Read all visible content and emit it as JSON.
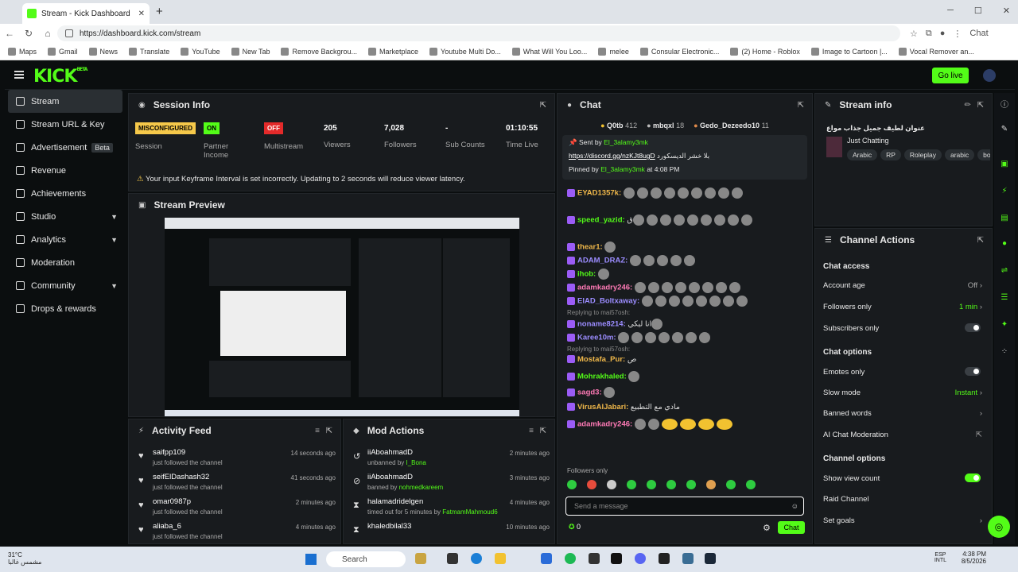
{
  "browser": {
    "tab_title": "Stream - Kick Dashboard",
    "url": "https://dashboard.kick.com/stream",
    "chat_label": "Chat",
    "bookmarks": [
      "Maps",
      "Gmail",
      "News",
      "Translate",
      "YouTube",
      "New Tab",
      "Remove Backgrou...",
      "Marketplace",
      "Youtube Multi Do...",
      "What Will You Loo...",
      "melee",
      "Consular Electronic...",
      "(2) Home - Roblox",
      "Image to Cartoon |...",
      "Vocal Remover an..."
    ]
  },
  "header": {
    "logo": "KICK",
    "logo_beta": "BETA",
    "go_live": "Go live"
  },
  "sidebar": {
    "items": [
      {
        "label": "Stream"
      },
      {
        "label": "Stream URL & Key"
      },
      {
        "label": "Advertisement",
        "badge": "Beta"
      },
      {
        "label": "Revenue"
      },
      {
        "label": "Achievements"
      },
      {
        "label": "Studio"
      },
      {
        "label": "Analytics"
      },
      {
        "label": "Moderation"
      },
      {
        "label": "Community"
      },
      {
        "label": "Drops & rewards"
      }
    ]
  },
  "session": {
    "title": "Session Info",
    "session_badge": "MISCONFIGURED",
    "session_label": "Session",
    "partner_badge": "ON",
    "partner_label": "Partner Income",
    "multistream_badge": "OFF",
    "multistream_label": "Multistream",
    "viewers": "205",
    "viewers_label": "Viewers",
    "followers": "7,028",
    "followers_label": "Followers",
    "subs": "-",
    "subs_label": "Sub Counts",
    "time": "01:10:55",
    "time_label": "Time Live",
    "warning": "Your input Keyframe Interval is set incorrectly. Updating to 2 seconds will reduce viewer latency."
  },
  "preview": {
    "title": "Stream Preview"
  },
  "activity": {
    "title": "Activity Feed",
    "items": [
      {
        "name": "saifpp109",
        "sub": "just followed the channel",
        "time": "14 seconds ago"
      },
      {
        "name": "seifElDashash32",
        "sub": "just followed the channel",
        "time": "41 seconds ago"
      },
      {
        "name": "omar0987p",
        "sub": "just followed the channel",
        "time": "2 minutes ago"
      },
      {
        "name": "aliaba_6",
        "sub": "just followed the channel",
        "time": "4 minutes ago"
      }
    ]
  },
  "mod": {
    "title": "Mod Actions",
    "items": [
      {
        "name": "iiAboahmadD",
        "sub": "unbanned by",
        "by": "I_Bona",
        "time": "2 minutes ago"
      },
      {
        "name": "iiAboahmadD",
        "sub": "banned by",
        "by": "nohmedkareem",
        "time": "3 minutes ago"
      },
      {
        "name": "halamadridelgen",
        "sub": "timed out for 5 minutes by",
        "by": "FatmamMahmoud6",
        "time": "4 minutes ago"
      },
      {
        "name": "khaledbilal33",
        "sub": "",
        "by": "",
        "time": "10 minutes ago"
      }
    ]
  },
  "chat": {
    "title": "Chat",
    "pins": [
      {
        "name": "Q0tb",
        "count": "412"
      },
      {
        "name": "mbqxl",
        "count": "18"
      },
      {
        "name": "Gedo_Dezeedo10",
        "count": "11"
      }
    ],
    "pinned_sent_by": "Sent by",
    "pinned_sender": "El_3alamy3mk",
    "pinned_link": "https://discord.gg/nzKJt8ugD",
    "pinned_text": "بلا خشر الديسكورد",
    "pinned_by": "Pinned by",
    "pinned_at": "at 4:08 PM",
    "messages": [
      {
        "user": "EYAD1357k:",
        "text": ""
      },
      {
        "user": "speed_yazid:",
        "text": "ق"
      },
      {
        "user": "thear1:",
        "text": ""
      },
      {
        "user": "ADAM_DRAZ:",
        "text": ""
      },
      {
        "user": "ihob:",
        "text": ""
      },
      {
        "user": "adamkadry246:",
        "text": ""
      },
      {
        "user": "ElAD_Boltxaway:",
        "text": ""
      },
      {
        "user": "noname8214:",
        "text": "انا ليكي",
        "reply": "Replying to mai57osh:"
      },
      {
        "user": "Karee10m:",
        "text": ""
      },
      {
        "user": "Mostafa_Pur:",
        "text": "ص",
        "reply": "Replying to mai57osh:"
      },
      {
        "user": "Mohrakhaled:",
        "text": ""
      },
      {
        "user": "sagd3:",
        "text": ""
      },
      {
        "user": "VirusAlJabari:",
        "text": "مادي مع التطبيع"
      },
      {
        "user": "adamkadry246:",
        "text": ""
      }
    ],
    "followers_only": "Followers only",
    "placeholder": "Send a message",
    "points": "0",
    "send": "Chat"
  },
  "stream_info": {
    "title": "Stream info",
    "stream_title": "عنوان لطيف جميل جذاب مواع",
    "category": "Just Chatting",
    "tags": [
      "Arabic",
      "RP",
      "Roleplay",
      "arabic",
      "bor"
    ]
  },
  "channel_actions": {
    "title": "Channel Actions",
    "chat_access": "Chat access",
    "account_age": "Account age",
    "account_age_val": "Off",
    "followers_only": "Followers only",
    "followers_only_val": "1 min",
    "subscribers_only": "Subscribers only",
    "chat_options": "Chat options",
    "emotes_only": "Emotes only",
    "slow_mode": "Slow mode",
    "slow_mode_val": "Instant",
    "banned_words": "Banned words",
    "ai_mod": "AI Chat Moderation",
    "channel_options": "Channel options",
    "show_view_count": "Show view count",
    "raid_channel": "Raid Channel",
    "set_goals": "Set goals"
  },
  "taskbar": {
    "temp": "31°C",
    "weather": "مشمس غالبا",
    "search": "Search",
    "lang": "ESP",
    "layout": "INTL",
    "time": "4:38 PM",
    "date": "8/5/2026"
  },
  "colors": {
    "accent": "#53fc18",
    "bg": "#0b0e0f",
    "panel": "#181b1e",
    "warn": "#f5c84a"
  }
}
